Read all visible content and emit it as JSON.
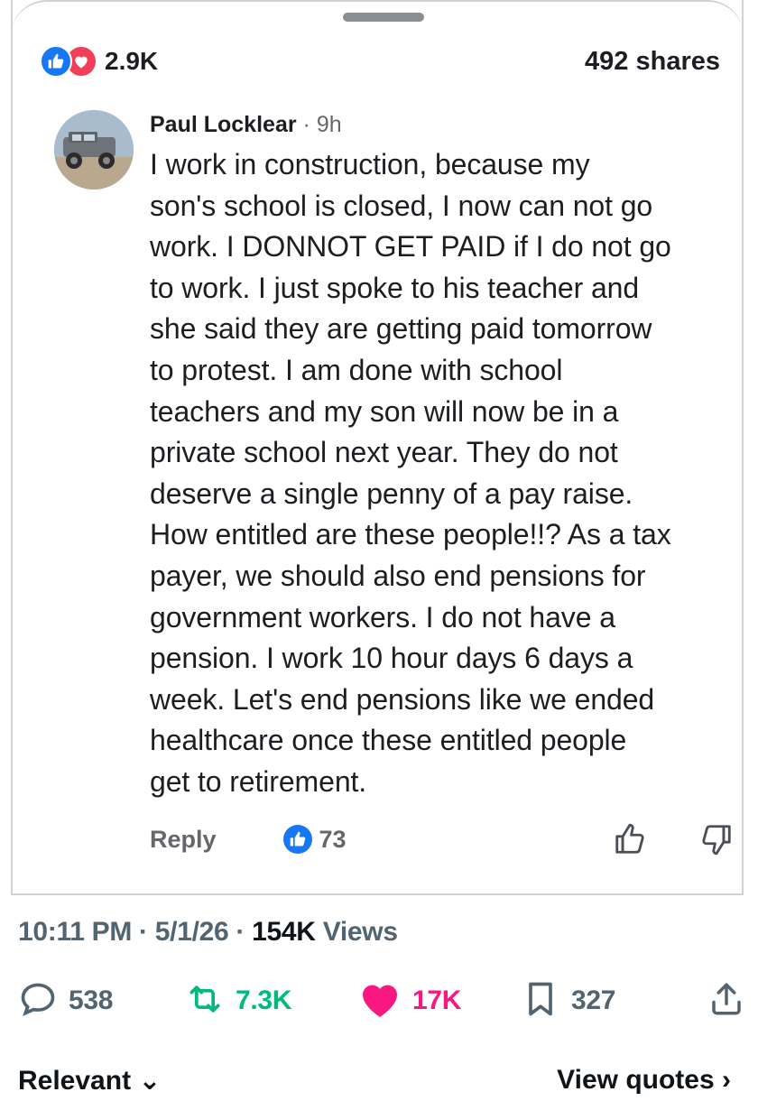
{
  "facebook_post": {
    "reactions_count": "2.9K",
    "shares": "492 shares",
    "comment": {
      "author": "Paul Locklear",
      "separator": "·",
      "time": "9h",
      "text": "I work in construction,  because my\nson's school is closed, I now can not go\nwork.  I DONNOT GET PAID if I do not go\nto work.  I just spoke to his teacher and\nshe said they are getting paid tomorrow\nto protest.  I am done with school\nteachers and my son will now be in a\nprivate school next year.  They do not\ndeserve a single penny of a pay raise.\nHow entitled are these people!!? As a tax\npayer, we should also end pensions for\ngovernment workers.  I do not have a\npension.  I work 10 hour days 6 days a\nweek.  Let's end pensions like we ended\nhealthcare once these entitled people\nget to retirement.",
      "reply_label": "Reply",
      "like_count": "73"
    },
    "colors": {
      "like_blue": "#1877f2",
      "love_red": "#f33e58"
    }
  },
  "tweet": {
    "time": "10:11 PM",
    "sep1": " · ",
    "date": "5/1/26",
    "sep2": " · ",
    "views_count": "154K",
    "views_label": " Views",
    "replies": "538",
    "retweets": "7.3K",
    "likes": "17K",
    "bookmarks": "327",
    "relevant_label": "Relevant ⌄",
    "view_quotes_label": "View quotes ›",
    "colors": {
      "retweet": "#00ba7c",
      "like": "#f91880",
      "muted": "#536471"
    }
  }
}
